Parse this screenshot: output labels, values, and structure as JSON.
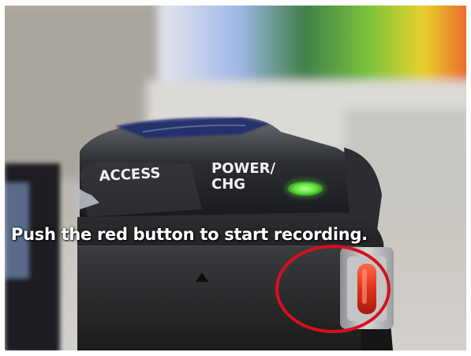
{
  "caption": "Push the red button to start recording.",
  "camera": {
    "label_access": "ACCESS",
    "label_power_line1": "POWER/",
    "label_power_line2": "CHG",
    "power_led_color": "#5fe23a",
    "record_button_color": "#e0301a",
    "highlight_circle_color": "#d8101c"
  },
  "icons": {
    "eject_arrow": "up-triangle-icon"
  }
}
